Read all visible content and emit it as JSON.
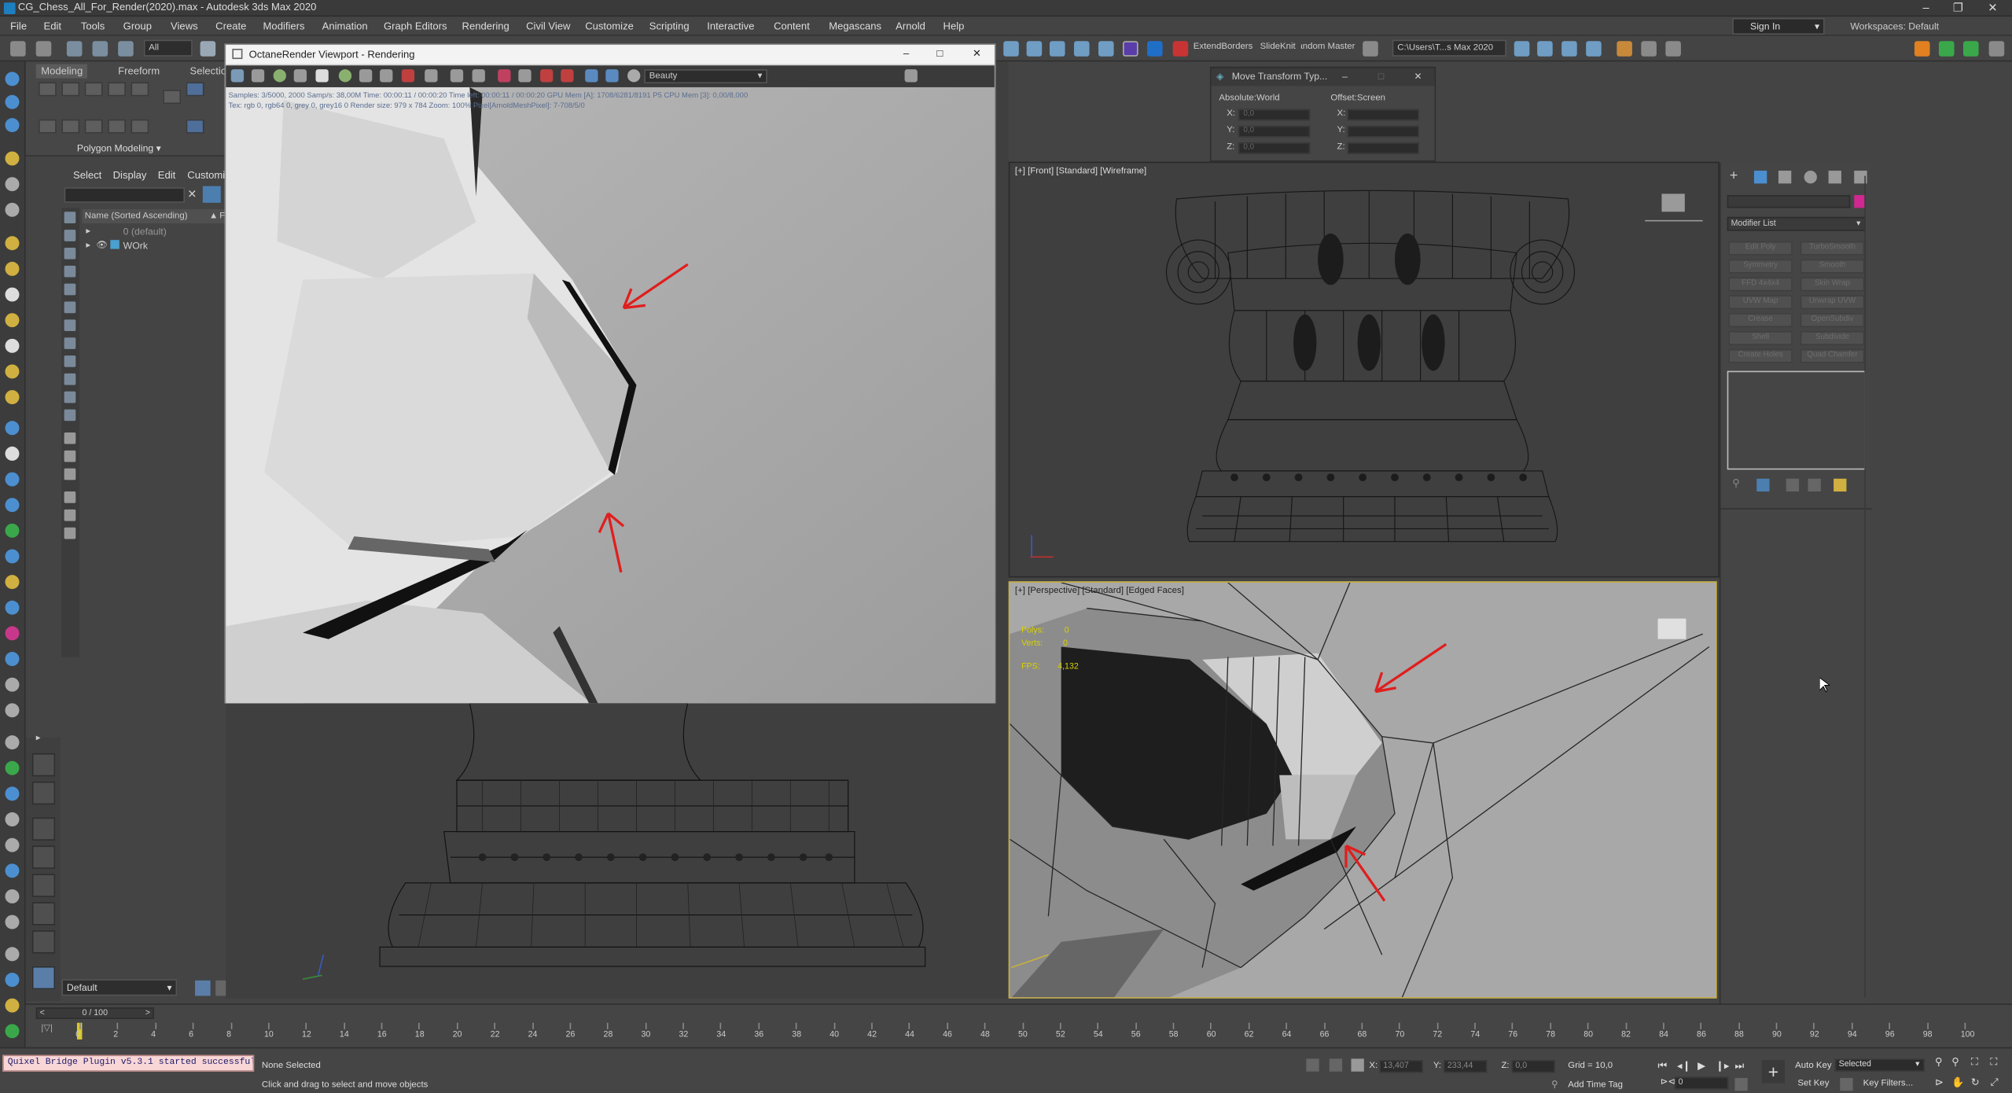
{
  "window": {
    "title": "CG_Chess_All_For_Render(2020).max - Autodesk 3ds Max 2020"
  },
  "menu": [
    "File",
    "Edit",
    "Tools",
    "Group",
    "Views",
    "Create",
    "Modifiers",
    "Animation",
    "Graph Editors",
    "Rendering",
    "Civil View",
    "Customize",
    "Scripting",
    "Interactive",
    "Content",
    "Megascans",
    "Arnold",
    "Help"
  ],
  "signin": "Sign In",
  "workspaces": {
    "label": "Workspaces:",
    "value": "Default"
  },
  "toolbar": {
    "selection_filter": "All",
    "scripts": [
      "ExtendBorders",
      "SlideKnit",
      "Random Master"
    ],
    "path_box": "C:\\Users\\T...s Max 2020"
  },
  "ribbon": {
    "tabs": [
      "Modeling",
      "Freeform",
      "Selection"
    ],
    "panel": "Polygon Modeling"
  },
  "scene_explorer": {
    "tabs": [
      "Select",
      "Display",
      "Edit",
      "Customize"
    ],
    "column": "Name (Sorted Ascending)",
    "column_extra": "F",
    "rows": [
      "0 (default)",
      "WOrk"
    ]
  },
  "octane": {
    "title": "OctaneRender Viewport - Rendering",
    "pass": "Beauty",
    "stats1": "Samples: 3/5000, 2000   Samp/s: 38,00M   Time: 00:00:11 / 00:00:20   Time left: 00:00:11 / 00:00:20   GPU Mem [A]: 1708/6281/8191 P5   CPU Mem [3]: 0,00/8,000",
    "stats2": "Tex: rgb 0, rgb64 0, grey 0, grey16 0   Render size: 979 x 784   Zoom: 100%   Pixel[ArnoldMeshPixel]: 7-708/5/0"
  },
  "move_transform": {
    "title": "Move Transform Typ...",
    "absolute": {
      "label": "Absolute:World",
      "x": "0,0",
      "y": "0,0",
      "z": "0,0"
    },
    "offset": {
      "label": "Offset:Screen",
      "x": "",
      "y": "",
      "z": ""
    }
  },
  "viewports": {
    "front": "[+] [Front] [Standard] [Wireframe]",
    "perspective": "[+] [Perspective] [Standard] [Edged Faces]",
    "stats": {
      "polys_label": "Polys:",
      "polys": "0",
      "verts_label": "Verts:",
      "verts": "0",
      "fps_label": "FPS:",
      "fps": "4,132"
    }
  },
  "command_panel": {
    "modifier_list": "Modifier List",
    "buttons": [
      [
        "Edit Poly",
        "TurboSmooth"
      ],
      [
        "Symmetry",
        "Smooth"
      ],
      [
        "FFD 4x4x4",
        "Skin Wrap"
      ],
      [
        "UVW Map",
        "Unwrap UVW"
      ],
      [
        "Crease",
        "OpenSubdiv"
      ],
      [
        "Shell",
        "Subdivide"
      ],
      [
        "Create Holes",
        "Quad Chamfer"
      ]
    ],
    "accent": "#d02890"
  },
  "layer": {
    "name": "Default"
  },
  "timeline": {
    "frame": "0 / 100",
    "ticks": [
      "0",
      "2",
      "4",
      "6",
      "8",
      "10",
      "12",
      "14",
      "16",
      "18",
      "20",
      "22",
      "24",
      "26",
      "28",
      "30",
      "32",
      "34",
      "36",
      "38",
      "40",
      "42",
      "44",
      "46",
      "48",
      "50",
      "52",
      "54",
      "56",
      "58",
      "60",
      "62",
      "64",
      "66",
      "68",
      "70",
      "72",
      "74",
      "76",
      "78",
      "80",
      "82",
      "84",
      "86",
      "88",
      "90",
      "92",
      "94",
      "96",
      "98",
      "100"
    ]
  },
  "status": {
    "plugin_msg": "Quixel Bridge Plugin v5.3.1 started successfully",
    "selection": "None Selected",
    "prompt": "Click and drag to select and move objects",
    "x_label": "X:",
    "x": "13,407",
    "y_label": "Y:",
    "y": "233,44",
    "z_label": "Z:",
    "z": "0,0",
    "grid": "Grid = 10,0",
    "add_time_tag": "Add Time Tag",
    "auto_key": "Auto Key",
    "set_key": "Set Key",
    "key_mode": "Selected",
    "frame_field": "0",
    "key_filters": "Key Filters..."
  }
}
